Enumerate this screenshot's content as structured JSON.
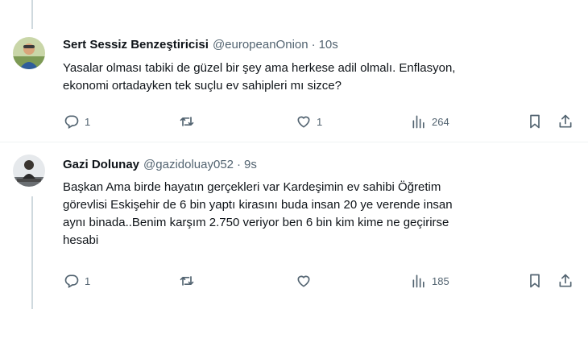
{
  "tweets": [
    {
      "name": "Sert Sessiz Benzeştiricisi",
      "handle": "@europeanOnion",
      "separator": "·",
      "time": "10s",
      "text": "Yasalar olması tabiki de güzel bir şey ama herkese adil olmalı. Enflasyon,\nekonomi ortadayken tek suçlu ev sahipleri mı sizce?",
      "reply_count": "1",
      "retweet_count": "",
      "like_count": "1",
      "view_count": "264"
    },
    {
      "name": "Gazi Dolunay",
      "handle": "@gazidoluay052",
      "separator": "·",
      "time": "9s",
      "text": "Başkan Ama birde hayatın gerçekleri var Kardeşimin ev sahibi Öğretim\ngörevlisi Eskişehir de 6 bin yaptı kirasını buda insan 20 ye verende insan\naynı binada..Benim karşım 2.750 veriyor ben 6 bin kim kime ne geçirirse\nhesabi",
      "reply_count": "1",
      "retweet_count": "",
      "like_count": "",
      "view_count": "185"
    }
  ],
  "icons": {
    "reply": "reply-icon",
    "retweet": "retweet-icon",
    "like": "heart-icon",
    "views": "views-icon",
    "bookmark": "bookmark-icon",
    "share": "share-icon"
  },
  "colors": {
    "text": "#0f1419",
    "secondary": "#536471",
    "thread_line": "#cfd9de",
    "divider": "#eff3f4"
  }
}
